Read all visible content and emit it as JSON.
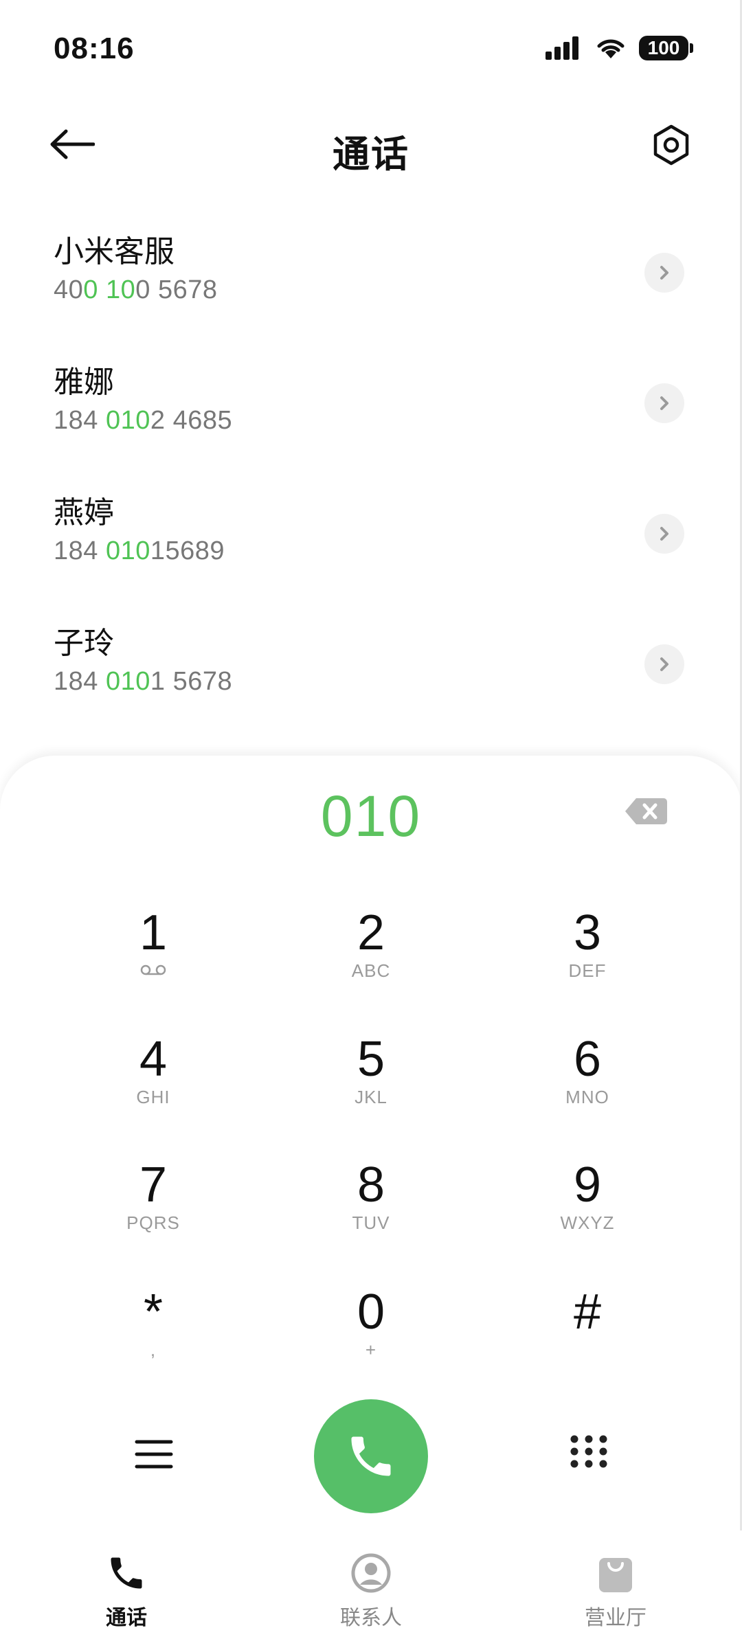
{
  "status": {
    "time": "08:16",
    "battery": "100"
  },
  "header": {
    "title": "通话"
  },
  "results": [
    {
      "name": "小米客服",
      "number_parts": [
        {
          "t": "40",
          "h": false
        },
        {
          "t": "0",
          "h": true
        },
        {
          "t": " ",
          "h": false
        },
        {
          "t": "10",
          "h": true
        },
        {
          "t": "0 5678",
          "h": false
        }
      ]
    },
    {
      "name": "雅娜",
      "number_parts": [
        {
          "t": "184 ",
          "h": false
        },
        {
          "t": "010",
          "h": true
        },
        {
          "t": "2 4685",
          "h": false
        }
      ]
    },
    {
      "name": "燕婷",
      "number_parts": [
        {
          "t": "184 ",
          "h": false
        },
        {
          "t": "010",
          "h": true
        },
        {
          "t": "15689",
          "h": false
        }
      ]
    },
    {
      "name": "子玲",
      "number_parts": [
        {
          "t": "184 ",
          "h": false
        },
        {
          "t": "010",
          "h": true
        },
        {
          "t": "1 5678",
          "h": false
        }
      ]
    }
  ],
  "dialpad": {
    "entered": "010",
    "keys": [
      {
        "digit": "1",
        "letters": "voicemail-icon"
      },
      {
        "digit": "2",
        "letters": "ABC"
      },
      {
        "digit": "3",
        "letters": "DEF"
      },
      {
        "digit": "4",
        "letters": "GHI"
      },
      {
        "digit": "5",
        "letters": "JKL"
      },
      {
        "digit": "6",
        "letters": "MNO"
      },
      {
        "digit": "7",
        "letters": "PQRS"
      },
      {
        "digit": "8",
        "letters": "TUV"
      },
      {
        "digit": "9",
        "letters": "WXYZ"
      },
      {
        "digit": "*",
        "letters": ","
      },
      {
        "digit": "0",
        "letters": "+"
      },
      {
        "digit": "#",
        "letters": ""
      }
    ]
  },
  "tabs": [
    {
      "label": "通话",
      "icon": "phone-icon",
      "active": true
    },
    {
      "label": "联系人",
      "icon": "contact-icon",
      "active": false
    },
    {
      "label": "营业厅",
      "icon": "shopping-bag-icon",
      "active": false
    }
  ],
  "colors": {
    "accent": "#4fc354",
    "call": "#56bf68"
  }
}
